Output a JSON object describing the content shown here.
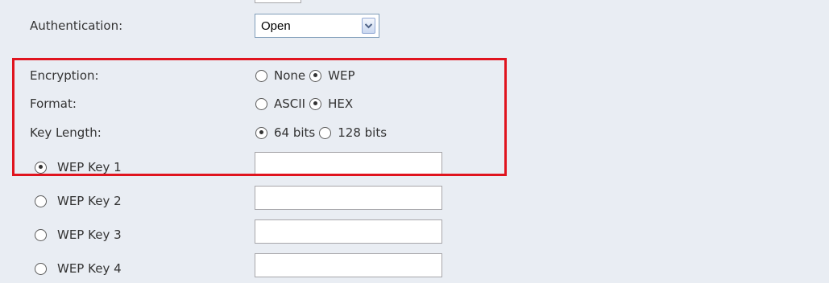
{
  "authentication": {
    "label": "Authentication:",
    "selected": "Open"
  },
  "encryption": {
    "label": "Encryption:",
    "options": [
      "None",
      "WEP"
    ],
    "selected": "WEP"
  },
  "format": {
    "label": "Format:",
    "options": [
      "ASCII",
      "HEX"
    ],
    "selected": "HEX"
  },
  "key_length": {
    "label": "Key Length:",
    "options": [
      "64 bits",
      "128 bits"
    ],
    "selected": "64 bits"
  },
  "wep_keys": [
    {
      "label": "WEP Key 1",
      "selected": true,
      "value": ""
    },
    {
      "label": "WEP Key 2",
      "selected": false,
      "value": ""
    },
    {
      "label": "WEP Key 3",
      "selected": false,
      "value": ""
    },
    {
      "label": "WEP Key 4",
      "selected": false,
      "value": ""
    }
  ],
  "colors": {
    "background": "#e9edf3",
    "highlight_border": "#e0141e"
  },
  "icons": {
    "select_arrow": "chevron-down-icon",
    "radio": "radio-button-icon"
  }
}
